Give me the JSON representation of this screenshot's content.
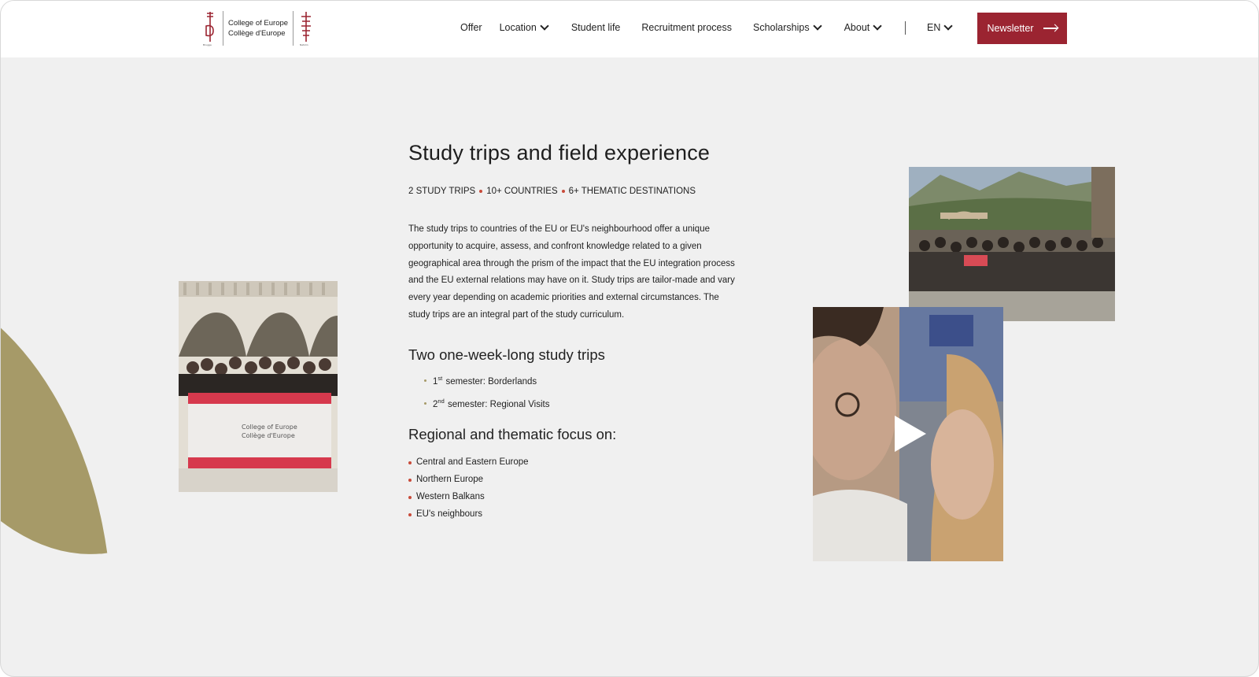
{
  "brand": {
    "name_en": "College of Europe",
    "name_fr": "Collège d'Europe",
    "accent_color": "#9b2431",
    "leaf_color": "#a69a68"
  },
  "nav": {
    "items": [
      {
        "label": "Offer",
        "has_dropdown": false
      },
      {
        "label": "Location",
        "has_dropdown": true
      },
      {
        "label": "Student life",
        "has_dropdown": false
      },
      {
        "label": "Recruitment process",
        "has_dropdown": false
      },
      {
        "label": "Scholarships",
        "has_dropdown": true
      },
      {
        "label": "About",
        "has_dropdown": true
      }
    ],
    "language": "EN",
    "newsletter_label": "Newsletter"
  },
  "main": {
    "title": "Study trips and field experience",
    "stats": [
      "2 STUDY TRIPS",
      "10+ COUNTRIES",
      "6+ THEMATIC DESTINATIONS"
    ],
    "description": "The study trips to countries of the EU or EU's neighbourhood offer a unique opportunity to acquire, assess, and confront knowledge related to a given geographical area through the prism of the impact that the EU integration process and the EU external relations may have on it. Study trips are tailor-made and vary every year depending on academic priorities and external circumstances. The study trips are an integral part of the study curriculum.",
    "trips_heading": "Two one-week-long study trips",
    "trips": [
      {
        "num": "1",
        "ordinal": "st",
        "text": "semester: Borderlands"
      },
      {
        "num": "2",
        "ordinal": "nd",
        "text": "semester: Regional Visits"
      }
    ],
    "focus_heading": "Regional and thematic focus on:",
    "regions": [
      "Central and Eastern Europe",
      "Northern Europe",
      "Western Balkans",
      "EU's neighbours"
    ]
  },
  "media": {
    "banner_line1": "College of Europe",
    "banner_line2": "Collège d'Europe"
  }
}
